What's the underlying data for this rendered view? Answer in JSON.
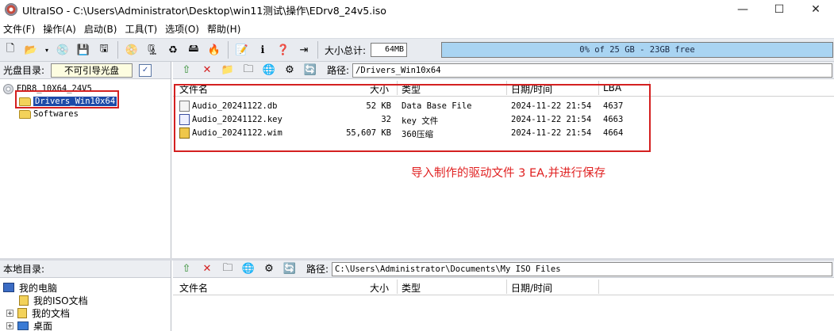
{
  "window": {
    "title": "UltraISO - C:\\Users\\Administrator\\Desktop\\win11测试\\操作\\EDrv8_24v5.iso",
    "minimize": "—",
    "maximize": "☐",
    "close": "✕"
  },
  "menu": {
    "items": [
      "文件(F)",
      "操作(A)",
      "启动(B)",
      "工具(T)",
      "选项(O)",
      "帮助(H)"
    ]
  },
  "toolbar": {
    "size_label": "大小总计:",
    "size_value": "64MB",
    "capacity_text": "0% of 25 GB - 23GB free",
    "capacity_used_fraction": 0.0
  },
  "iso_pane": {
    "label": "光盘目录:",
    "boot_status": "不可引导光盘",
    "tree": {
      "root": "EDR8_10X64_24V5",
      "children": [
        "Drivers_Win10x64",
        "Softwares"
      ],
      "selected": "Drivers_Win10x64"
    }
  },
  "iso_list": {
    "path_label": "路径:",
    "path": "/Drivers_Win10x64",
    "columns": [
      "文件名",
      "大小",
      "类型",
      "日期/时间",
      "LBA"
    ],
    "rows": [
      {
        "name": "Audio_20241122.db",
        "size": "52 KB",
        "type": "Data Base File",
        "date": "2024-11-22 21:54",
        "lba": "4637"
      },
      {
        "name": "Audio_20241122.key",
        "size": "32",
        "type": "key 文件",
        "date": "2024-11-22 21:54",
        "lba": "4663"
      },
      {
        "name": "Audio_20241122.wim",
        "size": "55,607 KB",
        "type": "360压缩",
        "date": "2024-11-22 21:54",
        "lba": "4664"
      }
    ],
    "annotation": "导入制作的驱动文件 3 EA,并进行保存"
  },
  "local_pane": {
    "label": "本地目录:",
    "tree": {
      "root": "我的电脑",
      "children": [
        "我的ISO文档",
        "我的文档",
        "桌面"
      ]
    }
  },
  "local_list": {
    "path_label": "路径:",
    "path": "C:\\Users\\Administrator\\Documents\\My ISO Files",
    "columns": [
      "文件名",
      "大小",
      "类型",
      "日期/时间"
    ]
  },
  "colors": {
    "highlight_red": "#d42020",
    "selection_blue": "#1c4aa8",
    "capacity_bar": "#a9d4f2"
  }
}
